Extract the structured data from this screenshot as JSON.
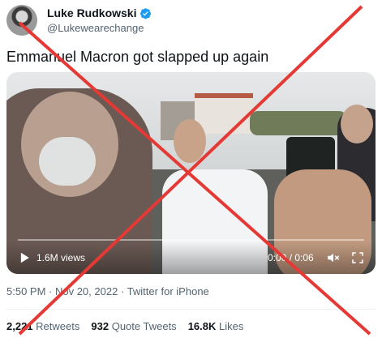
{
  "tweet": {
    "author_name": "Luke Rudkowski",
    "author_handle": "@Lukewearechange",
    "text": "Emmanuel Macron got slapped up again",
    "video": {
      "views": "1.6M views",
      "time": "0:00 / 0:06",
      "progress": 0
    },
    "meta": "5:50 PM · Nov 20, 2022 · Twitter for iPhone",
    "stats": {
      "retweets_count": "2,221",
      "retweets_label": "Retweets",
      "quotes_count": "932",
      "quotes_label": "Quote Tweets",
      "likes_count": "16.8K",
      "likes_label": "Likes"
    }
  },
  "colors": {
    "verified": "#1d9bf0",
    "overlay_x": "#e53935",
    "text_secondary": "#536471"
  },
  "icons": [
    "verified-badge-icon",
    "play-icon",
    "volume-icon",
    "fullscreen-icon"
  ]
}
